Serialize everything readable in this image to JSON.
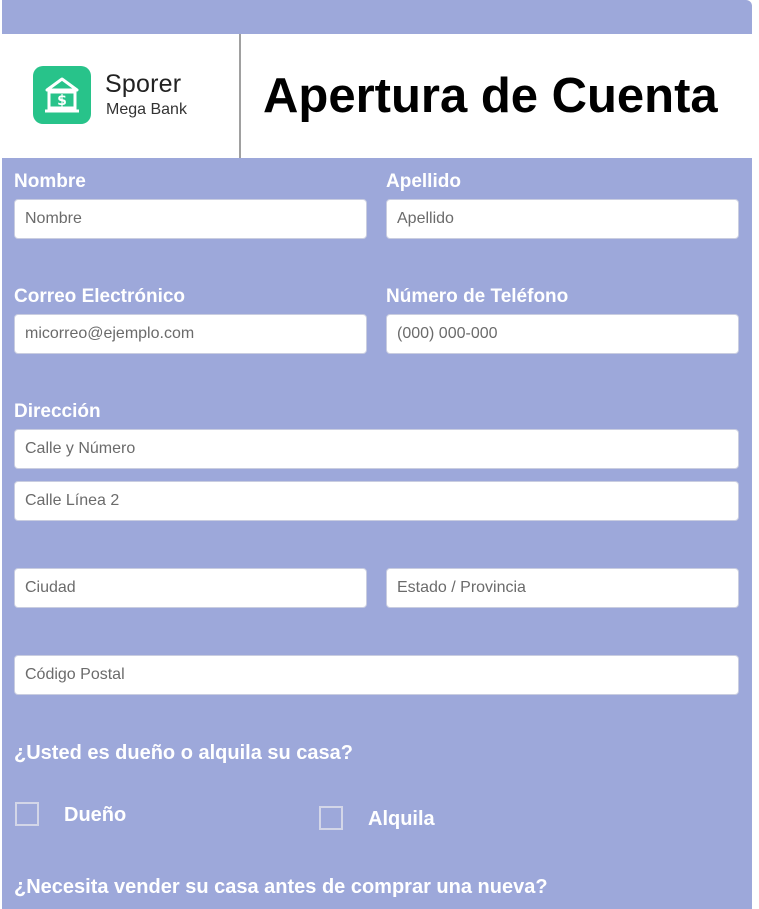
{
  "header": {
    "brand_name": "Sporer",
    "brand_sub": "Mega Bank",
    "title": "Apertura de Cuenta",
    "logo_icon": "bank-icon"
  },
  "fields": {
    "first_name": {
      "label": "Nombre",
      "placeholder": "Nombre"
    },
    "last_name": {
      "label": "Apellido",
      "placeholder": "Apellido"
    },
    "email": {
      "label": "Correo Electrónico",
      "placeholder": "micorreo@ejemplo.com"
    },
    "phone": {
      "label": "Número de Teléfono",
      "placeholder": "(000) 000-000"
    },
    "address": {
      "label": "Dirección",
      "street": "Calle y Número",
      "street2": "Calle Línea 2",
      "city": "Ciudad",
      "state": "Estado / Provincia",
      "zip": "Código Postal"
    }
  },
  "questions": {
    "ownership": {
      "text": "¿Usted es dueño o alquila su casa?",
      "options": [
        "Dueño",
        "Alquila"
      ]
    },
    "sell_first": {
      "text": "¿Necesita vender su casa antes de comprar una nueva?"
    }
  },
  "colors": {
    "form_background": "#9da8da",
    "logo_green": "#28c38a"
  }
}
